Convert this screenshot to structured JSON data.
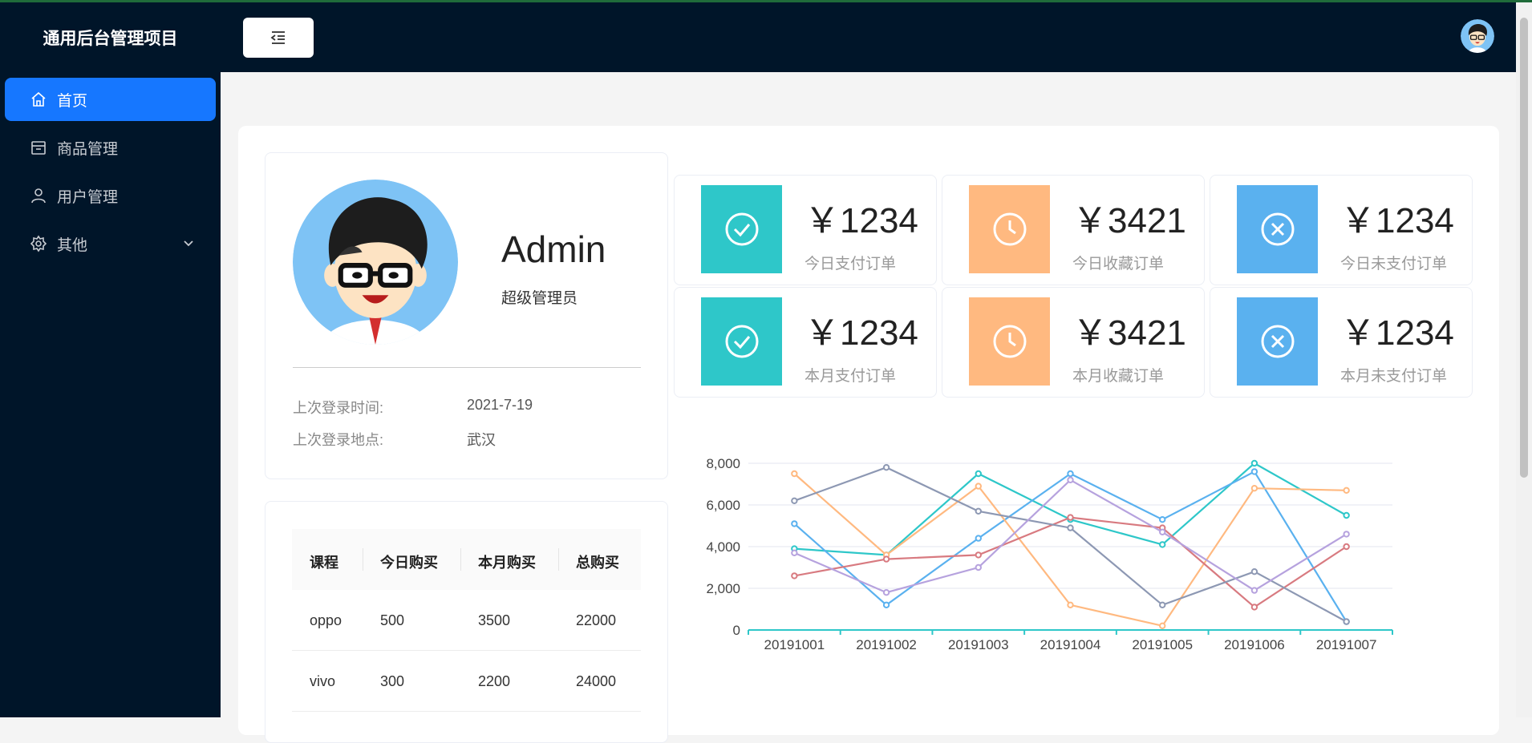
{
  "app": {
    "title": "通用后台管理项目"
  },
  "sidebar": {
    "items": [
      {
        "label": "首页",
        "icon": "home-icon",
        "active": true
      },
      {
        "label": "商品管理",
        "icon": "shop-icon"
      },
      {
        "label": "用户管理",
        "icon": "user-icon"
      },
      {
        "label": "其他",
        "icon": "setting-icon",
        "has_submenu": true
      }
    ]
  },
  "header": {
    "toggle_icon": "menu-fold-icon",
    "avatar_icon": "user-avatar-icon"
  },
  "user": {
    "name": "Admin",
    "role": "超级管理员",
    "last_login_time_label": "上次登录时间:",
    "last_login_time": "2021-7-19",
    "last_login_place_label": "上次登录地点:",
    "last_login_place": "武汉"
  },
  "table": {
    "headers": [
      "课程",
      "今日购买",
      "本月购买",
      "总购买"
    ],
    "rows": [
      [
        "oppo",
        "500",
        "3500",
        "22000"
      ],
      [
        "vivo",
        "300",
        "2200",
        "24000"
      ]
    ]
  },
  "stats": [
    {
      "value": "￥1234",
      "label": "今日支付订单",
      "color": "#2ec7c9",
      "icon": "check-circle-icon"
    },
    {
      "value": "￥3421",
      "label": "今日收藏订单",
      "color": "#ffb980",
      "icon": "clock-icon"
    },
    {
      "value": "￥1234",
      "label": "今日未支付订单",
      "color": "#5ab1ef",
      "icon": "close-circle-icon"
    },
    {
      "value": "￥1234",
      "label": "本月支付订单",
      "color": "#2ec7c9",
      "icon": "check-circle-icon"
    },
    {
      "value": "￥3421",
      "label": "本月收藏订单",
      "color": "#ffb980",
      "icon": "clock-icon"
    },
    {
      "value": "￥1234",
      "label": "本月未支付订单",
      "color": "#5ab1ef",
      "icon": "close-circle-icon"
    }
  ],
  "chart_data": {
    "type": "line",
    "x": [
      "20191001",
      "20191002",
      "20191003",
      "20191004",
      "20191005",
      "20191006",
      "20191007"
    ],
    "ylim": [
      0,
      8000
    ],
    "yticks": [
      "0",
      "2,000",
      "4,000",
      "6,000",
      "8,000"
    ],
    "grid": true,
    "series": [
      {
        "color": "#2ec7c9",
        "values": [
          3900,
          3600,
          7500,
          5300,
          4100,
          8000,
          5500
        ]
      },
      {
        "color": "#5ab1ef",
        "values": [
          5100,
          1200,
          4400,
          7500,
          5300,
          7600,
          400
        ]
      },
      {
        "color": "#ffb980",
        "values": [
          7500,
          3600,
          6900,
          1200,
          200,
          6800,
          6700
        ]
      },
      {
        "color": "#d87a80",
        "values": [
          2600,
          3400,
          3600,
          5400,
          4900,
          1100,
          4000
        ]
      },
      {
        "color": "#8d98b3",
        "values": [
          6200,
          7800,
          5700,
          4900,
          1200,
          2800,
          400
        ]
      },
      {
        "color": "#b6a2de",
        "values": [
          3700,
          1800,
          3000,
          7200,
          4700,
          1900,
          4600
        ]
      }
    ]
  }
}
